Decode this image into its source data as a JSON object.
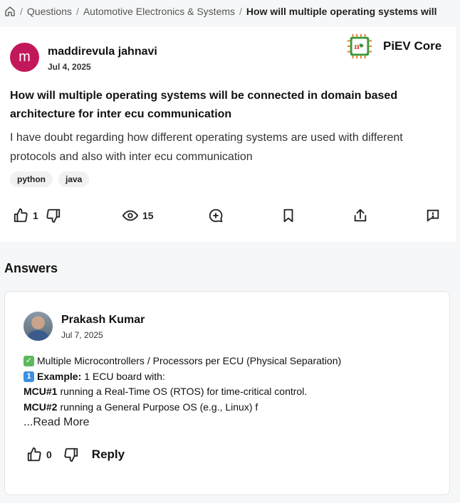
{
  "breadcrumb": {
    "home_icon": "home-icon",
    "items": [
      "Questions",
      "Automotive Electronics & Systems"
    ],
    "current": "How will multiple operating systems will"
  },
  "question": {
    "avatar_letter": "m",
    "avatar_color": "#c2185b",
    "author": "maddirevula jahnavi",
    "date": "Jul 4, 2025",
    "brand_name": "PiEV Core",
    "title": "How will multiple operating systems will be connected in domain based architecture for inter ecu communication",
    "body": "I have doubt regarding how different operating systems are used with different protocols and also with inter ecu communication",
    "tags": [
      "python",
      "java"
    ],
    "likes": "1",
    "views": "15"
  },
  "answers": {
    "heading": "Answers",
    "items": [
      {
        "author": "Prakash Kumar",
        "date": "Jul 7, 2025",
        "line1": "Multiple Microcontrollers / Processors per ECU (Physical Separation)",
        "line2_label": "Example:",
        "line2_text": "1 ECU board with:",
        "line3_label": "MCU#1",
        "line3_text": "running a Real-Time OS (RTOS) for time-critical control.",
        "line4_label": "MCU#2",
        "line4_text": "running a General Purpose OS (e.g., Linux) f",
        "read_more": "...Read More",
        "likes": "0",
        "reply_label": "Reply"
      }
    ]
  }
}
